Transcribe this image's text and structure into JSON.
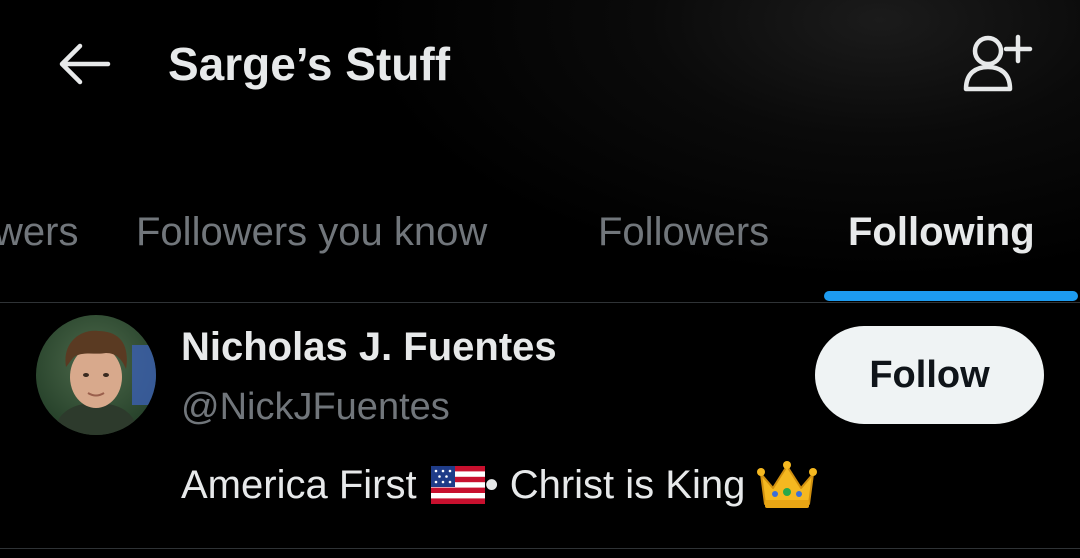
{
  "header": {
    "title": "Sarge’s Stuff"
  },
  "tabs": [
    {
      "label": "wers",
      "active": false
    },
    {
      "label": "Followers you know",
      "active": false
    },
    {
      "label": "Followers",
      "active": false
    },
    {
      "label": "Following",
      "active": true
    }
  ],
  "users": [
    {
      "display_name": "Nicholas J. Fuentes",
      "handle": "@NickJFuentes",
      "follow_label": "Follow",
      "bio_part1": "America First",
      "bio_flag_icon": "us-flag-icon",
      "bio_part2": " • Christ is King",
      "bio_crown_icon": "crown-icon"
    }
  ],
  "colors": {
    "background": "#000000",
    "text_primary": "#e7e9ea",
    "text_secondary": "#71767b",
    "accent": "#1d9bf0",
    "button_bg": "#eff3f4",
    "button_text": "#0f1419",
    "divider": "#2f3336"
  }
}
